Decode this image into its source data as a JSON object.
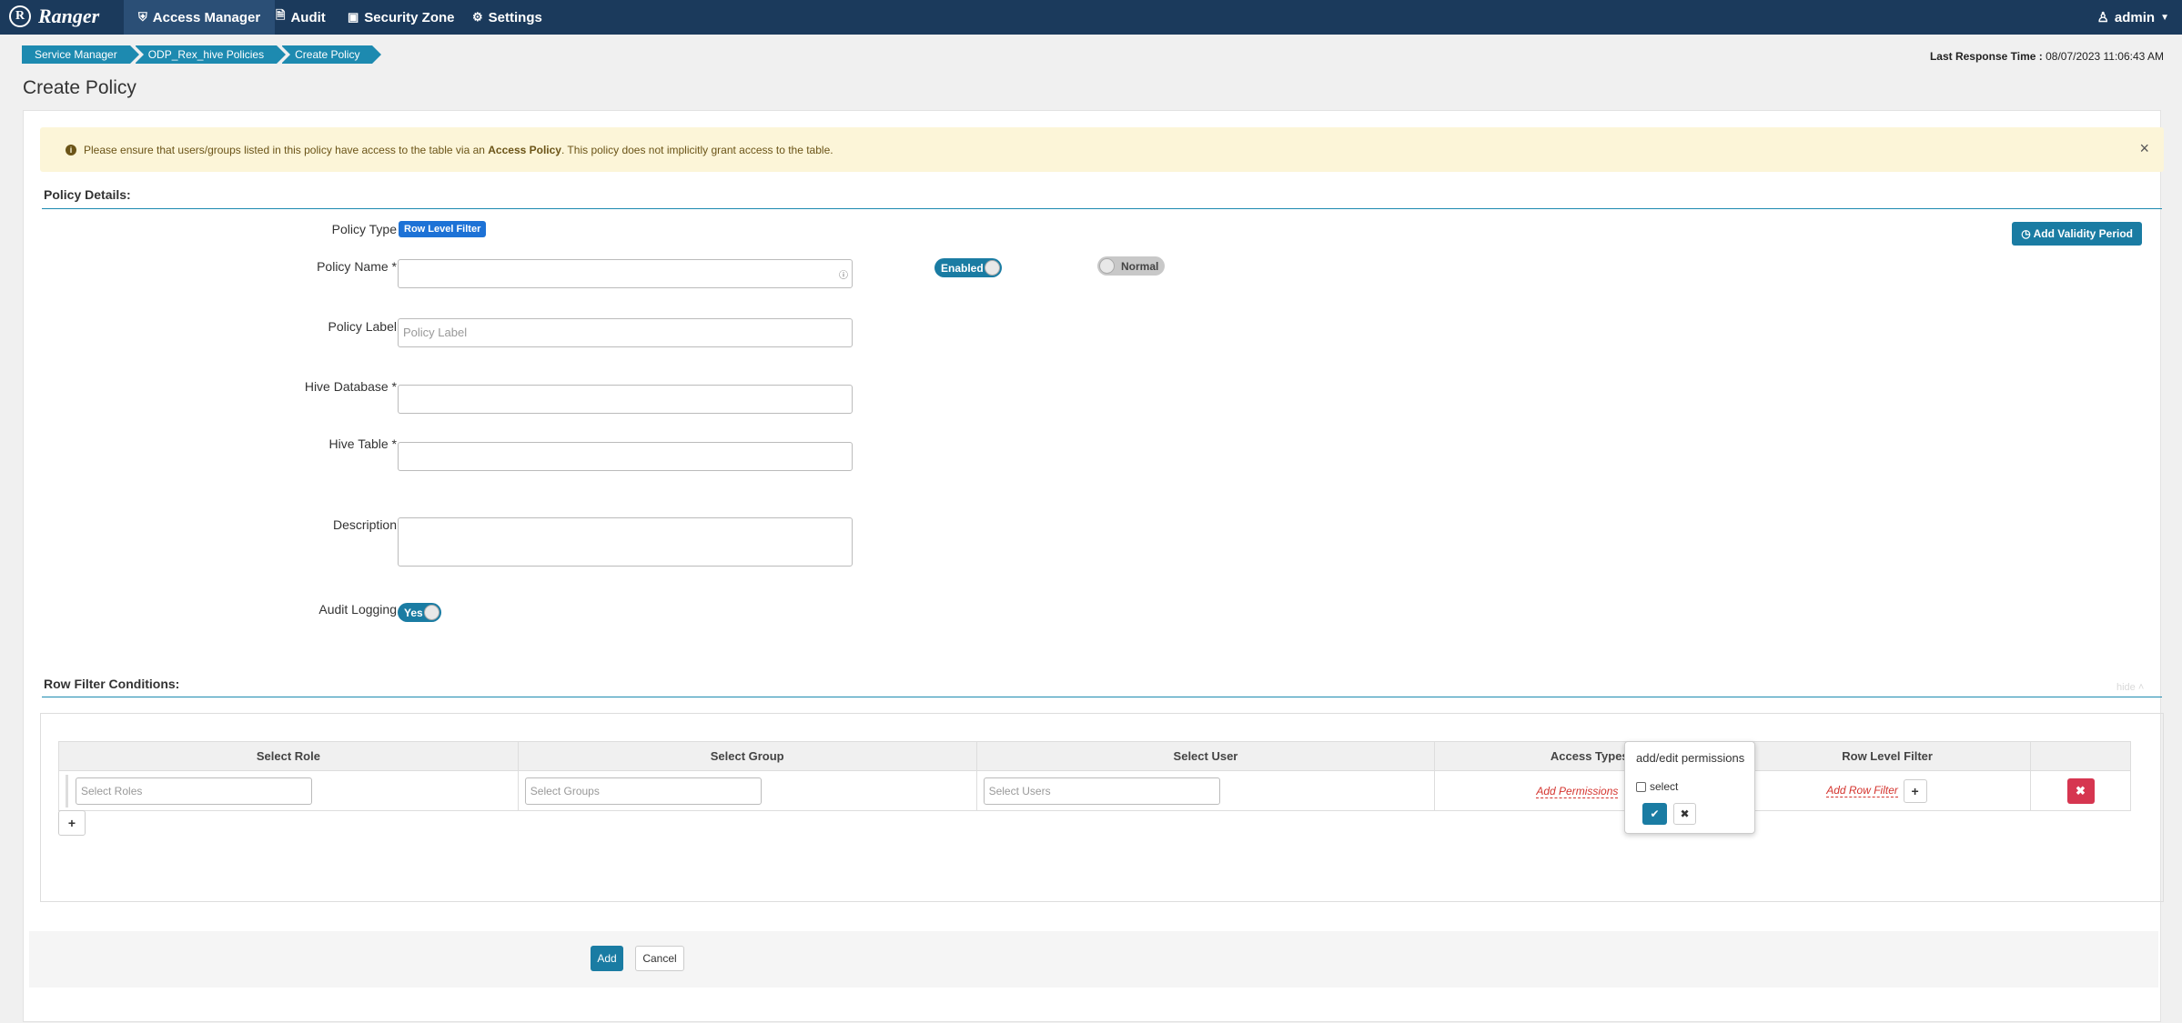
{
  "nav": {
    "brand": "Ranger",
    "brand_logo": "R",
    "items": [
      {
        "label": "Access Manager",
        "icon": "shield-icon"
      },
      {
        "label": "Audit",
        "icon": "file-icon"
      },
      {
        "label": "Security Zone",
        "icon": "zone-icon"
      },
      {
        "label": "Settings",
        "icon": "gear-icon"
      }
    ],
    "user": "admin"
  },
  "breadcrumb": [
    "Service Manager",
    "ODP_Rex_hive Policies",
    "Create Policy"
  ],
  "last_response": {
    "label": "Last Response Time :",
    "value": "08/07/2023 11:06:43 AM"
  },
  "page_title": "Create Policy",
  "alert": {
    "text_before": "Please ensure that users/groups listed in this policy have access to the table via an ",
    "text_bold": "Access Policy",
    "text_after": ". This policy does not implicitly grant access to the table."
  },
  "policy_details": {
    "heading": "Policy Details:",
    "policy_type_label": "Policy Type",
    "policy_type_value": "Row Level Filter",
    "policy_name_label": "Policy Name *",
    "policy_label_label": "Policy Label",
    "policy_label_placeholder": "Policy Label",
    "hive_db_label": "Hive Database *",
    "hive_table_label": "Hive Table *",
    "description_label": "Description",
    "audit_logging_label": "Audit Logging",
    "audit_toggle": "Yes",
    "enabled_toggle": "Enabled",
    "normal_toggle": "Normal",
    "validity_button": "Add Validity Period"
  },
  "row_filter": {
    "heading": "Row Filter Conditions:",
    "hide": "hide",
    "columns": [
      "Select Role",
      "Select Group",
      "Select User",
      "Access Types",
      "Row Level Filter"
    ],
    "role_placeholder": "Select Roles",
    "group_placeholder": "Select Groups",
    "user_placeholder": "Select Users",
    "add_permissions": "Add Permissions",
    "add_row_filter": "Add Row Filter"
  },
  "popover": {
    "title": "add/edit permissions",
    "option": "select"
  },
  "footer": {
    "add": "Add",
    "cancel": "Cancel"
  },
  "colors": {
    "nav_bg": "#1b3a5c",
    "accent": "#1a7ca3",
    "danger": "#d63650",
    "alert_bg": "#fcf5d8"
  }
}
